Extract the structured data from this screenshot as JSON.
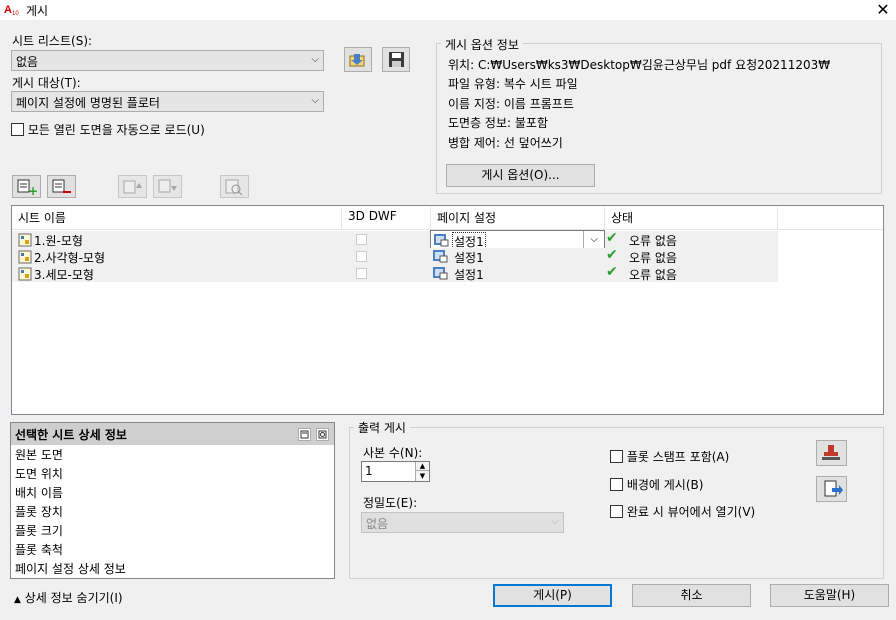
{
  "window": {
    "title": "게시",
    "close": "✕"
  },
  "sheet_list": {
    "label": "시트 리스트(S):",
    "value": "없음"
  },
  "publish_to": {
    "label": "게시 대상(T):",
    "value": "페이지 설정에 명명된 플로터"
  },
  "auto_load": {
    "label": "모든 열린 도면을 자동으로 로드(U)",
    "checked": false
  },
  "publish_options_info": {
    "title": "게시 옵션 정보",
    "location": "위치: C:₩Users₩ks3₩Desktop₩김윤근상무님 pdf 요청20211203₩",
    "file_type": "파일 유형: 복수 시트 파일",
    "naming": "이름 지정: 이름 프롬프트",
    "layer_info": "도면층 정보: 불포함",
    "merge_control": "병합 제어: 선 덮어쓰기",
    "button": "게시 옵션(O)..."
  },
  "table": {
    "headers": [
      "시트 이름",
      "3D DWF",
      "페이지 설정",
      "상태"
    ],
    "rows": [
      {
        "name": "1.원-모형",
        "page_setup": "설정1",
        "status": "오류 없음"
      },
      {
        "name": "2.사각형-모형",
        "page_setup": "설정1",
        "status": "오류 없음"
      },
      {
        "name": "3.세모-모형",
        "page_setup": "설정1",
        "status": "오류 없음"
      }
    ]
  },
  "details": {
    "title": "선택한 시트 상세 정보",
    "items": [
      "원본 도면",
      "도면 위치",
      "배치 이름",
      "플롯 장치",
      "플롯 크기",
      "플롯 축척",
      "페이지 설정 상세 정보"
    ],
    "hide_link": "상세 정보 숨기기(I)"
  },
  "output": {
    "title": "출력 게시",
    "copies_label": "사본 수(N):",
    "copies_value": "1",
    "precision_label": "정밀도(E):",
    "precision_value": "없음",
    "stamp_label": "플롯 스탬프 포함(A)",
    "background_label": "배경에 게시(B)",
    "open_viewer_label": "완료 시 뷰어에서 열기(V)"
  },
  "buttons": {
    "publish": "게시(P)",
    "cancel": "취소",
    "help": "도움말(H)"
  }
}
